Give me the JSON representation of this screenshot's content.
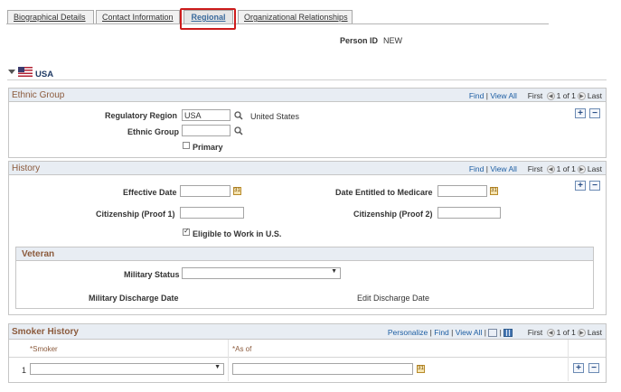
{
  "tabs": [
    {
      "label": "Biographical Details"
    },
    {
      "label": "Contact Information"
    },
    {
      "label": "Regional"
    },
    {
      "label": "Organizational Relationships"
    }
  ],
  "person": {
    "label": "Person ID",
    "value": "NEW"
  },
  "country": {
    "label": "USA",
    "icon": "us-flag-icon"
  },
  "ethnic": {
    "title": "Ethnic Group",
    "find": "Find",
    "view_all": "View All",
    "first": "First",
    "count": "1 of 1",
    "last": "Last",
    "reg_region_label": "Regulatory Region",
    "reg_region_value": "USA",
    "reg_region_desc": "United States",
    "ethnic_group_label": "Ethnic Group",
    "ethnic_group_value": "",
    "primary_label": "Primary",
    "primary_checked": false
  },
  "history": {
    "title": "History",
    "find": "Find",
    "view_all": "View All",
    "first": "First",
    "count": "1 of 1",
    "last": "Last",
    "effective_date_label": "Effective Date",
    "medicare_label": "Date Entitled to Medicare",
    "citizenship1_label": "Citizenship (Proof 1)",
    "citizenship2_label": "Citizenship (Proof 2)",
    "eligible_label": "Eligible to Work in U.S.",
    "eligible_checked": true
  },
  "veteran": {
    "title": "Veteran",
    "military_status_label": "Military Status",
    "military_status_value": "",
    "discharge_label": "Military Discharge Date",
    "edit_discharge_label": "Edit Discharge Date"
  },
  "smoker": {
    "title": "Smoker History",
    "personalize": "Personalize",
    "find": "Find",
    "view_all": "View All",
    "first": "First",
    "count": "1 of 1",
    "last": "Last",
    "col_smoker": "*Smoker",
    "col_asof": "*As of",
    "row_num": "1"
  }
}
